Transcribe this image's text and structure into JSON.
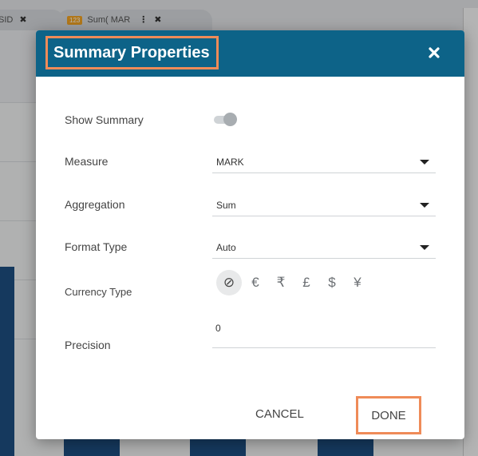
{
  "background": {
    "tabs": [
      {
        "label": "SID",
        "close": "✖"
      },
      {
        "badge": "123",
        "label": "Sum( MAR",
        "more": "⋮",
        "close": "✖"
      }
    ]
  },
  "modal": {
    "title": "Summary Properties",
    "close_icon": "close-icon",
    "rows": {
      "show_summary": {
        "label": "Show Summary",
        "enabled": true
      },
      "measure": {
        "label": "Measure",
        "value": "MARK"
      },
      "aggregation": {
        "label": "Aggregation",
        "value": "Sum"
      },
      "format_type": {
        "label": "Format Type",
        "value": "Auto"
      },
      "currency_type": {
        "label": "Currency Type",
        "options": [
          "⊘",
          "€",
          "₹",
          "£",
          "$",
          "¥"
        ],
        "selected_index": 0
      },
      "precision": {
        "label": "Precision",
        "value": "0"
      }
    },
    "buttons": {
      "cancel": "CANCEL",
      "done": "DONE"
    },
    "colors": {
      "header": "#0d6388",
      "highlight": "#ef8b58"
    }
  }
}
